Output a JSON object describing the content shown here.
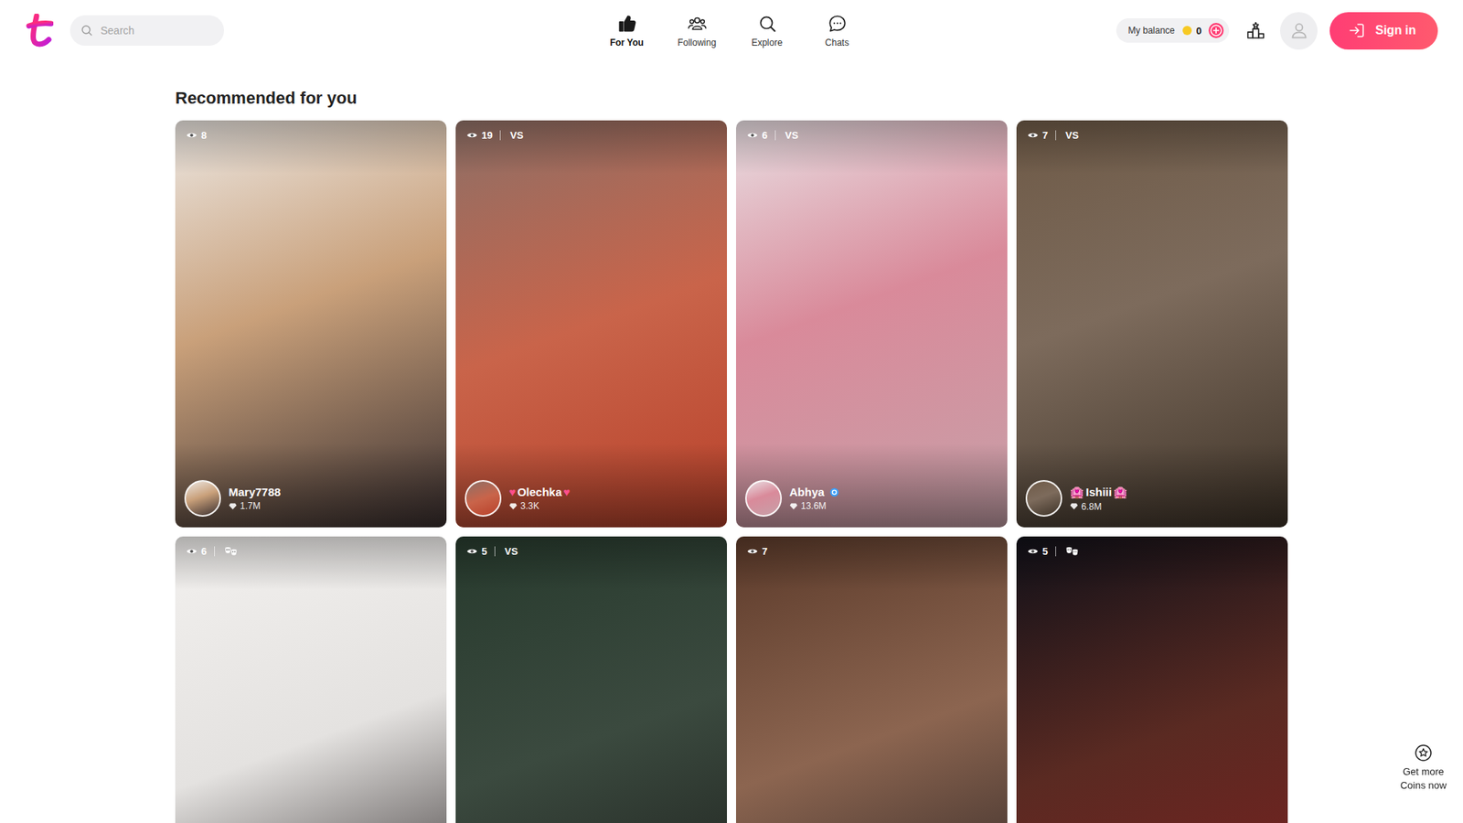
{
  "header": {
    "search": {
      "placeholder": "Search"
    },
    "nav": [
      {
        "label": "For You",
        "selected": true
      },
      {
        "label": "Following",
        "selected": false
      },
      {
        "label": "Explore",
        "selected": false
      },
      {
        "label": "Chats",
        "selected": false
      }
    ],
    "balance": {
      "label": "My balance",
      "amount": "0"
    },
    "sign_in": "Sign in"
  },
  "section": {
    "title": "Recommended for you"
  },
  "streams": [
    {
      "viewers": "8",
      "mode": "none",
      "mode_label": "",
      "name": "Mary7788",
      "prefix": "",
      "suffix": "",
      "verified": false,
      "diamonds": "1.7M"
    },
    {
      "viewers": "19",
      "mode": "vs",
      "mode_label": "VS",
      "name": "Olechka",
      "prefix": "♥",
      "suffix": "♥",
      "verified": false,
      "diamonds": "3.3K"
    },
    {
      "viewers": "6",
      "mode": "vs",
      "mode_label": "VS",
      "name": "Abhya",
      "prefix": "",
      "suffix": "",
      "verified": true,
      "diamonds": "13.6M"
    },
    {
      "viewers": "7",
      "mode": "vs",
      "mode_label": "VS",
      "name": "Ishiii",
      "prefix": "🏩",
      "suffix": "🏩",
      "verified": false,
      "diamonds": "6.8M"
    },
    {
      "viewers": "6",
      "mode": "party",
      "mode_label": "",
      "name": "",
      "prefix": "",
      "suffix": "",
      "verified": false,
      "diamonds": ""
    },
    {
      "viewers": "5",
      "mode": "vs",
      "mode_label": "VS",
      "name": "",
      "prefix": "",
      "suffix": "",
      "verified": false,
      "diamonds": ""
    },
    {
      "viewers": "7",
      "mode": "none",
      "mode_label": "",
      "name": "",
      "prefix": "",
      "suffix": "",
      "verified": false,
      "diamonds": ""
    },
    {
      "viewers": "5",
      "mode": "party",
      "mode_label": "",
      "name": "",
      "prefix": "",
      "suffix": "",
      "verified": false,
      "diamonds": ""
    }
  ],
  "promo": {
    "text": "Get more Coins now"
  }
}
